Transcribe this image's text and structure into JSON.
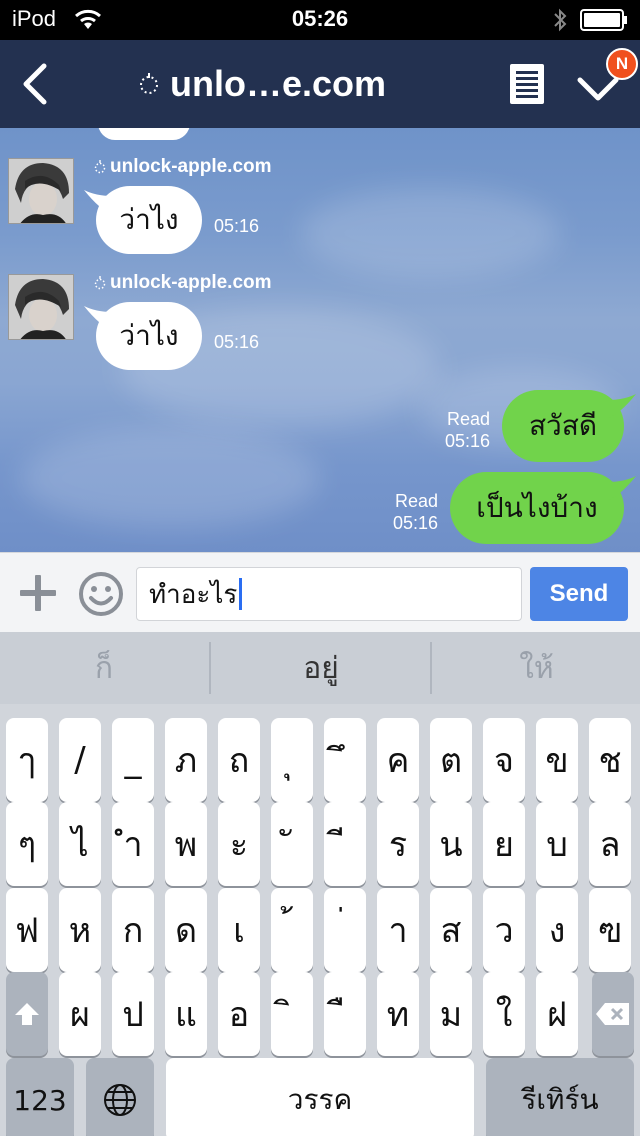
{
  "status_bar": {
    "carrier": "iPod",
    "time": "05:26"
  },
  "header": {
    "title": "unlo…e.com",
    "badge": "N"
  },
  "messages_in": [
    {
      "sender": "unlock-apple.com",
      "text": "ว่าไง",
      "time": "05:16"
    },
    {
      "sender": "unlock-apple.com",
      "text": "ว่าไง",
      "time": "05:16"
    }
  ],
  "messages_out": [
    {
      "text": "สวัสดี",
      "status": "Read",
      "time": "05:16"
    },
    {
      "text": "เป็นไงบ้าง",
      "status": "Read",
      "time": "05:16"
    }
  ],
  "input": {
    "value": "ทำอะไร",
    "send_label": "Send"
  },
  "keyboard": {
    "suggestions": [
      "ก็",
      "อยู่",
      "ให้"
    ],
    "row1": [
      "ๅ",
      "/",
      "_",
      "ภ",
      "ถ",
      "ุ",
      "ึ",
      "ค",
      "ต",
      "จ",
      "ข",
      "ช"
    ],
    "row2": [
      "ๆ",
      "ไ",
      "ำ",
      "พ",
      "ะ",
      "ั",
      "ี",
      "ร",
      "น",
      "ย",
      "บ",
      "ล"
    ],
    "row3": [
      "ฟ",
      "ห",
      "ก",
      "ด",
      "เ",
      "้",
      "่",
      "า",
      "ส",
      "ว",
      "ง",
      "ฃ"
    ],
    "row4": [
      "ผ",
      "ป",
      "แ",
      "อ",
      "ิ",
      "ื",
      "ท",
      "ม",
      "ใ",
      "ฝ"
    ],
    "numbers_label": "123",
    "space_label": "วรรค",
    "return_label": "รีเทิร์น"
  },
  "colors": {
    "header": "#233150",
    "outgoing_bubble": "#71d34b",
    "send_button": "#4d85e5",
    "badge": "#f0501e"
  }
}
